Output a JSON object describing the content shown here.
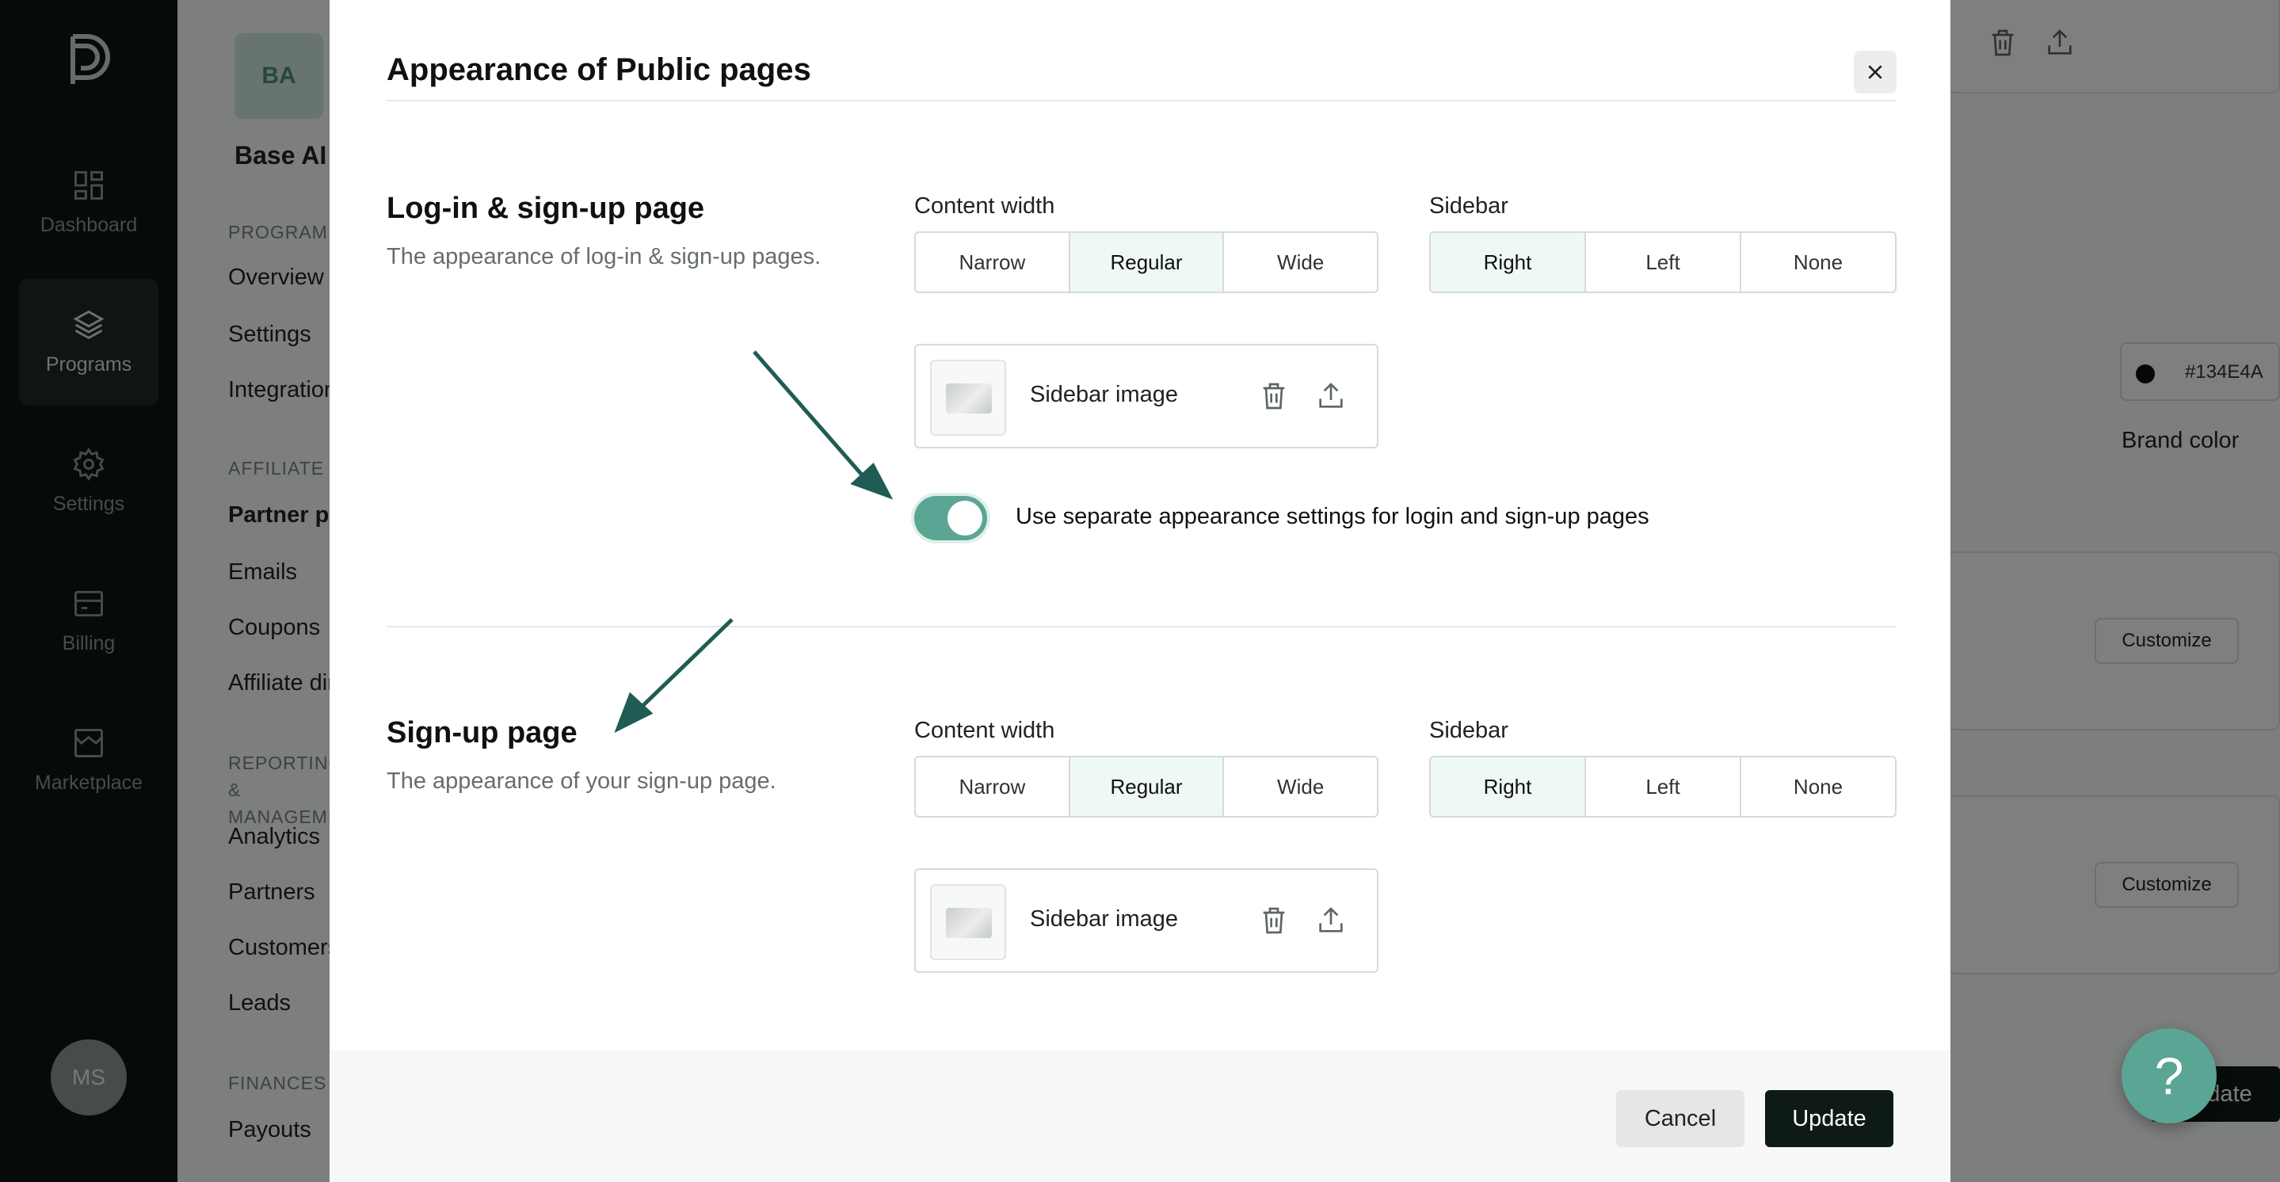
{
  "rail": {
    "items": [
      {
        "label": "Dashboard",
        "icon": "dashboard-icon"
      },
      {
        "label": "Programs",
        "icon": "layers-icon",
        "active": true
      },
      {
        "label": "Settings",
        "icon": "gear-icon"
      },
      {
        "label": "Billing",
        "icon": "billing-icon"
      },
      {
        "label": "Marketplace",
        "icon": "store-icon"
      }
    ],
    "avatar": "MS"
  },
  "background": {
    "workspace_badge": "BA",
    "workspace_name": "Base AI",
    "sections": {
      "program": "PROGRAM",
      "affiliate": "AFFILIATE",
      "reporting": "REPORTING & MANAGEMENT",
      "finances": "FINANCES"
    },
    "links": {
      "overview": "Overview",
      "settings": "Settings",
      "integrations": "Integrations",
      "partner_pages": "Partner pages",
      "emails": "Emails",
      "coupons": "Coupons",
      "affiliate_directory": "Affiliate directory",
      "analytics": "Analytics",
      "partners": "Partners",
      "customers": "Customers",
      "leads": "Leads",
      "payouts": "Payouts"
    },
    "color_value": "#134E4A",
    "color_label": "Brand color",
    "customize_label": "Customize",
    "update_label": "Update"
  },
  "modal": {
    "title": "Appearance of Public pages",
    "login_section": {
      "title": "Log-in & sign-up page",
      "description": "The appearance of log-in & sign-up pages.",
      "content_width_label": "Content width",
      "content_width_options": [
        "Narrow",
        "Regular",
        "Wide"
      ],
      "content_width_selected": "Regular",
      "sidebar_label": "Sidebar",
      "sidebar_options": [
        "Right",
        "Left",
        "None"
      ],
      "sidebar_selected": "Right",
      "sidebar_image_label": "Sidebar image",
      "toggle_label": "Use separate appearance settings for login and sign-up pages",
      "toggle_on": true
    },
    "signup_section": {
      "title": "Sign-up page",
      "description": "The appearance of your sign-up page.",
      "content_width_label": "Content width",
      "content_width_options": [
        "Narrow",
        "Regular",
        "Wide"
      ],
      "content_width_selected": "Regular",
      "sidebar_label": "Sidebar",
      "sidebar_options": [
        "Right",
        "Left",
        "None"
      ],
      "sidebar_selected": "Right",
      "sidebar_image_label": "Sidebar image"
    },
    "footer": {
      "cancel": "Cancel",
      "update": "Update"
    }
  },
  "help_label": "?",
  "colors": {
    "accent": "#5aa593",
    "arrow": "#1f5c55",
    "primary_button": "#0e1a16",
    "rail": "#0c1613"
  }
}
